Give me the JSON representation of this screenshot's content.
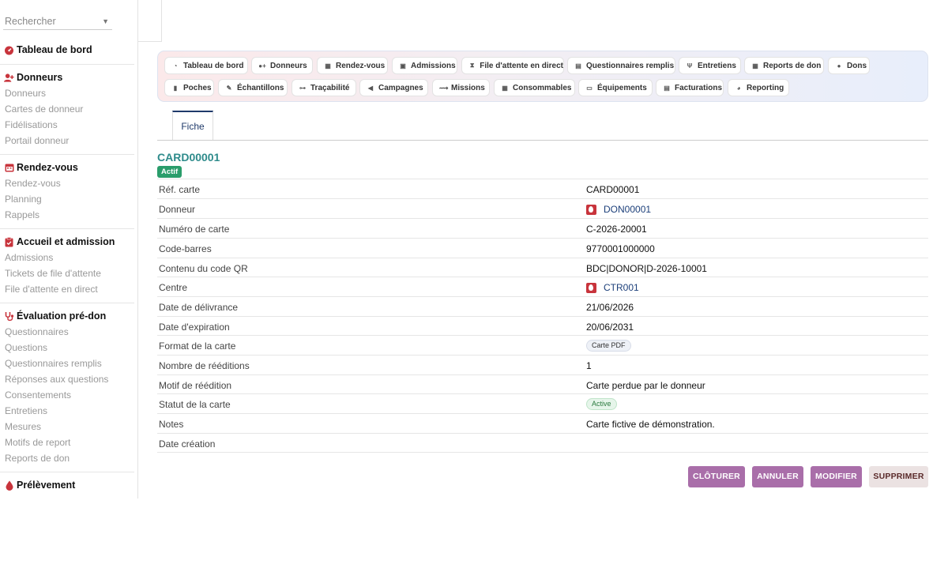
{
  "search": {
    "placeholder": "Rechercher"
  },
  "sidebar": {
    "groups": [
      {
        "title": "Tableau de bord",
        "items": []
      },
      {
        "title": "Donneurs",
        "items": [
          "Donneurs",
          "Cartes de donneur",
          "Fidélisations",
          "Portail donneur"
        ]
      },
      {
        "title": "Rendez-vous",
        "items": [
          "Rendez-vous",
          "Planning",
          "Rappels"
        ]
      },
      {
        "title": "Accueil et admission",
        "items": [
          "Admissions",
          "Tickets de file d'attente",
          "File d'attente en direct"
        ]
      },
      {
        "title": "Évaluation pré-don",
        "items": [
          "Questionnaires",
          "Questions",
          "Questionnaires remplis",
          "Réponses aux questions",
          "Consentements",
          "Entretiens",
          "Mesures",
          "Motifs de report",
          "Reports de don"
        ]
      },
      {
        "title": "Prélèvement",
        "items": []
      }
    ]
  },
  "tabs": [
    "Tableau de bord",
    "Donneurs",
    "Rendez-vous",
    "Admissions",
    "File d'attente en direct",
    "Questionnaires remplis",
    "Entretiens",
    "Reports de don",
    "Dons",
    "Poches",
    "Échantillons",
    "Traçabilité",
    "Campagnes",
    "Missions",
    "Consommables",
    "Équipements",
    "Facturations",
    "Reporting"
  ],
  "detail_tab": "Fiche",
  "record": {
    "title": "CARD00001",
    "status_badge": "Actif",
    "fields": [
      {
        "label": "Réf. carte",
        "value": "CARD00001"
      },
      {
        "label": "Donneur",
        "value": "DON00001"
      },
      {
        "label": "Numéro de carte",
        "value": "C-2026-20001"
      },
      {
        "label": "Code-barres",
        "value": "9770001000000"
      },
      {
        "label": "Contenu du code QR",
        "value": "BDC|DONOR|D-2026-10001"
      },
      {
        "label": "Centre",
        "value": "CTR001"
      },
      {
        "label": "Date de délivrance",
        "value": "21/06/2026"
      },
      {
        "label": "Date d'expiration",
        "value": "20/06/2031"
      },
      {
        "label": "Format de la carte",
        "value": "Carte PDF"
      },
      {
        "label": "Nombre de rééditions",
        "value": "1"
      },
      {
        "label": "Motif de réédition",
        "value": "Carte perdue par le donneur"
      },
      {
        "label": "Statut de la carte",
        "value": "Active"
      },
      {
        "label": "Notes",
        "value": "Carte fictive de démonstration."
      },
      {
        "label": "Date création",
        "value": ""
      }
    ]
  },
  "actions": {
    "close": "CLÔTURER",
    "cancel": "ANNULER",
    "edit": "MODIFIER",
    "delete": "SUPPRIMER"
  },
  "colors": {
    "brand_red": "#c8343c",
    "title_teal": "#2e8b8b",
    "badge_green": "#2a9d6b",
    "button_purple": "#a96ea9",
    "link_blue": "#1c3f7a"
  }
}
